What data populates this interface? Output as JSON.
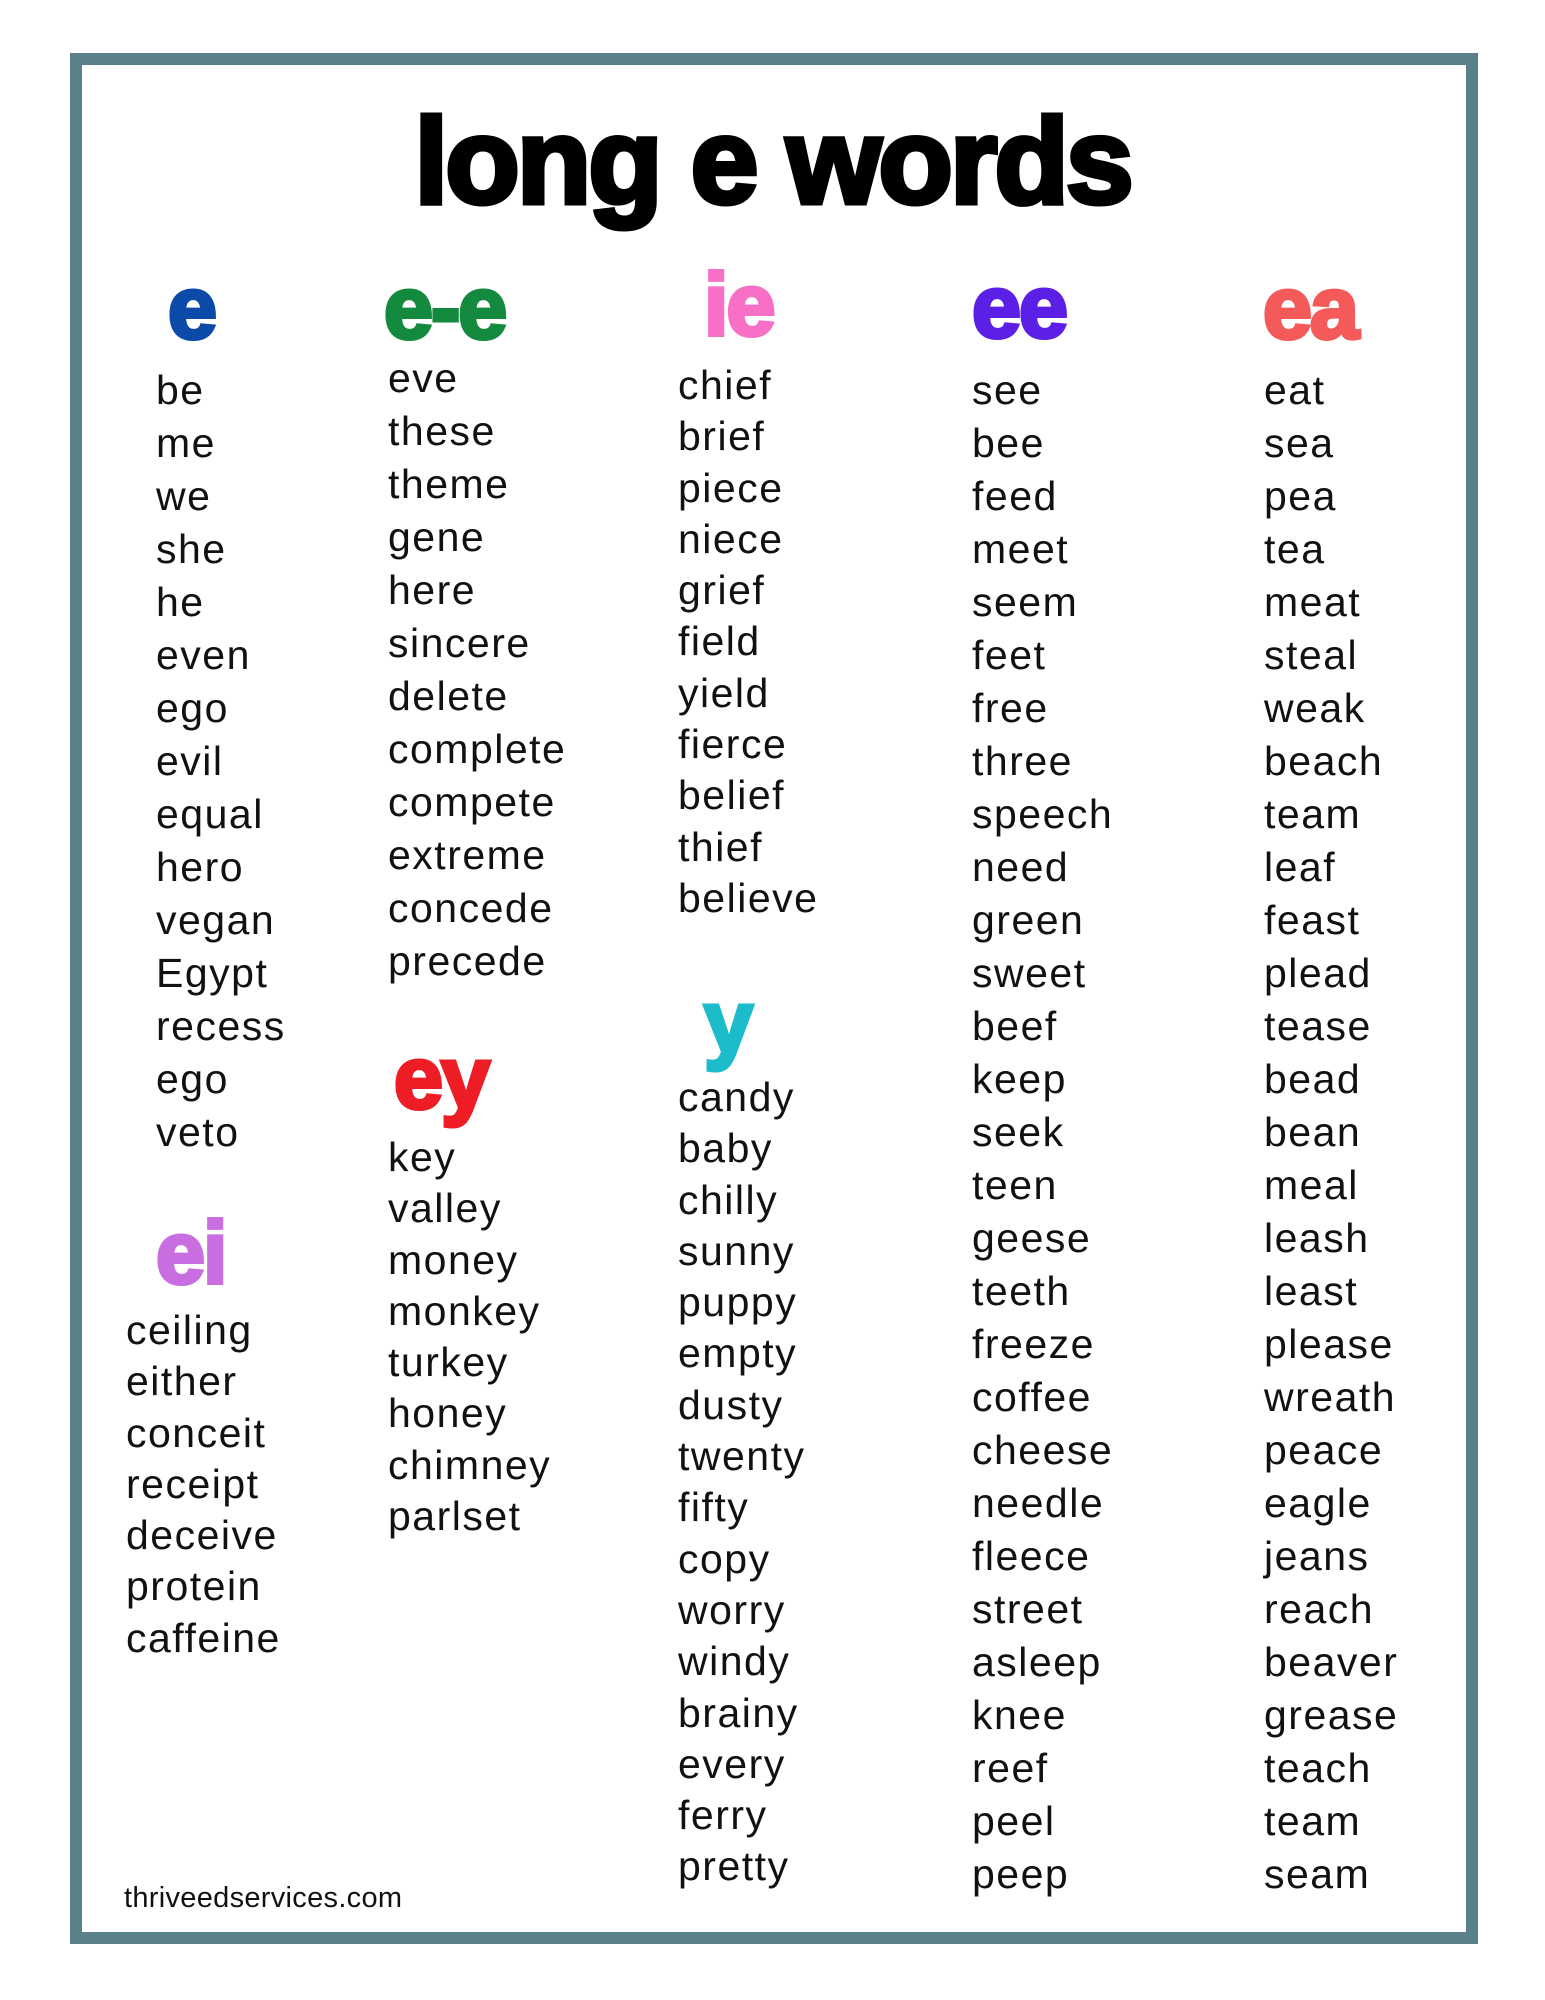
{
  "title": "long e words",
  "footer": "thriveedservices.com",
  "colors": {
    "frame": "#5a8189",
    "e": "#0b4aa8",
    "e-e": "#138a3e",
    "ie": "#f86fc6",
    "ee": "#5b1fe6",
    "ea": "#f45a5a",
    "y": "#1cbccb",
    "ey": "#ee1c24",
    "ei": "#c86ee0"
  },
  "sections": {
    "e": {
      "header": "e",
      "words": [
        "be",
        "me",
        "we",
        "she",
        "he",
        "even",
        "ego",
        "evil",
        "equal",
        "hero",
        "vegan",
        "Egypt",
        "recess",
        "ego",
        "veto"
      ]
    },
    "e_e": {
      "header": "e-e",
      "words": [
        "eve",
        "these",
        "theme",
        "gene",
        "here",
        "sincere",
        "delete",
        "complete",
        "compete",
        "extreme",
        "concede",
        "precede"
      ]
    },
    "ie": {
      "header": "ie",
      "words": [
        "chief",
        "brief",
        "piece",
        "niece",
        "grief",
        "field",
        "yield",
        "fierce",
        "belief",
        "thief",
        "believe"
      ]
    },
    "ee": {
      "header": "ee",
      "words": [
        "see",
        "bee",
        "feed",
        "meet",
        "seem",
        "feet",
        "free",
        "three",
        "speech",
        "need",
        "green",
        "sweet",
        "beef",
        "keep",
        "seek",
        "teen",
        "geese",
        "teeth",
        "freeze",
        "coffee",
        "cheese",
        "needle",
        "fleece",
        "street",
        "asleep",
        "knee",
        "reef",
        "peel",
        "peep"
      ]
    },
    "ea": {
      "header": "ea",
      "words": [
        "eat",
        "sea",
        "pea",
        "tea",
        "meat",
        "steal",
        "weak",
        "beach",
        "team",
        "leaf",
        "feast",
        "plead",
        "tease",
        "bead",
        "bean",
        "meal",
        "leash",
        "least",
        "please",
        "wreath",
        "peace",
        "eagle",
        "jeans",
        "reach",
        "beaver",
        "grease",
        "teach",
        "team",
        "seam"
      ]
    },
    "ei": {
      "header": "ei",
      "words": [
        "ceiling",
        "either",
        "conceit",
        "receipt",
        "deceive",
        "protein",
        "caffeine"
      ]
    },
    "ey": {
      "header": "ey",
      "words": [
        "key",
        "valley",
        "money",
        "monkey",
        "turkey",
        "honey",
        "chimney",
        "parlset"
      ]
    },
    "y": {
      "header": "y",
      "words": [
        "candy",
        "baby",
        "chilly",
        "sunny",
        "puppy",
        "empty",
        "dusty",
        "twenty",
        "fifty",
        "copy",
        "worry",
        "windy",
        "brainy",
        "every",
        "ferry",
        "pretty"
      ]
    }
  }
}
